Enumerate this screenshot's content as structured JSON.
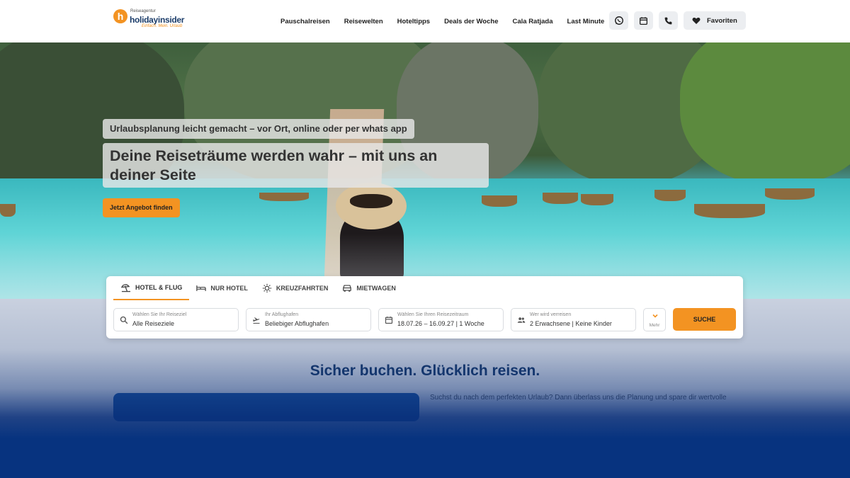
{
  "header": {
    "logo": {
      "mark": "h",
      "small": "Reiseagentur",
      "main": "holidayinsider",
      "tagline": "Einfach. Mein. Urlaub"
    },
    "nav": [
      "Pauschalreisen",
      "Reisewelten",
      "Hoteltipps",
      "Deals der Woche",
      "Cala Ratjada",
      "Last Minute"
    ],
    "favorites_label": "Favoriten",
    "icons": [
      "whatsapp-icon",
      "calendar-icon",
      "phone-icon",
      "heart-icon"
    ]
  },
  "hero": {
    "subtitle": "Urlaubsplanung leicht gemacht – vor Ort, online oder per whats app",
    "title": "Deine Reiseträume werden wahr – mit uns an deiner Seite",
    "cta": "Jetzt Angebot finden"
  },
  "search": {
    "tabs": [
      {
        "label": "HOTEL & FLUG",
        "icon": "beach-icon",
        "active": true
      },
      {
        "label": "NUR HOTEL",
        "icon": "bed-icon",
        "active": false
      },
      {
        "label": "KREUZFAHRTEN",
        "icon": "sun-icon",
        "active": false
      },
      {
        "label": "MIETWAGEN",
        "icon": "car-icon",
        "active": false
      }
    ],
    "fields": [
      {
        "label": "Wählen Sie Ihr Reiseziel",
        "value": "Alle Reiseziele",
        "icon": "search-icon"
      },
      {
        "label": "Ihr Abflughafen",
        "value": "Beliebiger Abflughafen",
        "icon": "plane-icon"
      },
      {
        "label": "Wählen Sie Ihren Reisezeitraum",
        "value": "18.07.26 – 16.09.27 | 1 Woche",
        "icon": "calendar-icon"
      },
      {
        "label": "Wer wird verreisen",
        "value": "2 Erwachsene | Keine Kinder",
        "icon": "people-icon"
      }
    ],
    "more_label": "Mehr",
    "submit_label": "SUCHE"
  },
  "section": {
    "title": "Sicher buchen. Glücklich reisen.",
    "intro": "Suchst du nach dem perfekten Urlaub? Dann überlass uns die Planung und spare dir wertvolle"
  },
  "colors": {
    "accent": "#f39322",
    "brand_blue": "#1c3d6a",
    "overlay_blue": "#07337f"
  }
}
